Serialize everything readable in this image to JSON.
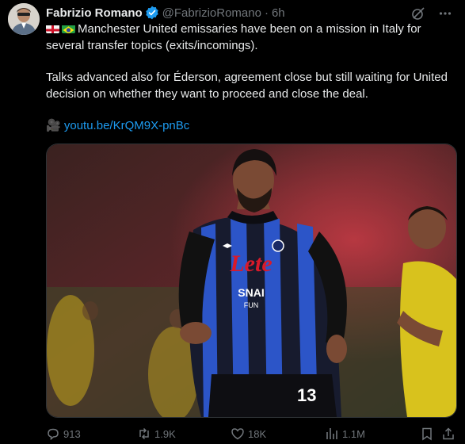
{
  "author": {
    "name": "Fabrizio Romano",
    "handle": "@FabrizioRomano",
    "separator": "·",
    "time": "6h"
  },
  "tweet": {
    "line1": "Manchester United emissaries have been on a mission in Italy for several transfer topics (exits/incomings).",
    "line2": "Talks advanced also for Éderson, agreement close but still waiting for United decision on whether they want to proceed and close the deal.",
    "link_emoji": "🎥",
    "link": "youtu.be/KrQM9X-pnBc"
  },
  "media": {
    "shirt_sponsor": "Lete",
    "sleeve_sponsor": "SNAI",
    "sleeve_sponsor_sub": "FUN",
    "shirt_number": "13"
  },
  "actions": {
    "replies": "913",
    "reposts": "1.9K",
    "likes": "18K",
    "views": "1.1M"
  },
  "icons": [
    "verified-badge-icon",
    "grok-icon",
    "more-icon",
    "reply-icon",
    "repost-icon",
    "like-icon",
    "views-icon",
    "bookmark-icon",
    "share-icon"
  ],
  "colors": {
    "link": "#1d9bf0",
    "muted": "#71767b",
    "verified": "#1d9bf0"
  }
}
